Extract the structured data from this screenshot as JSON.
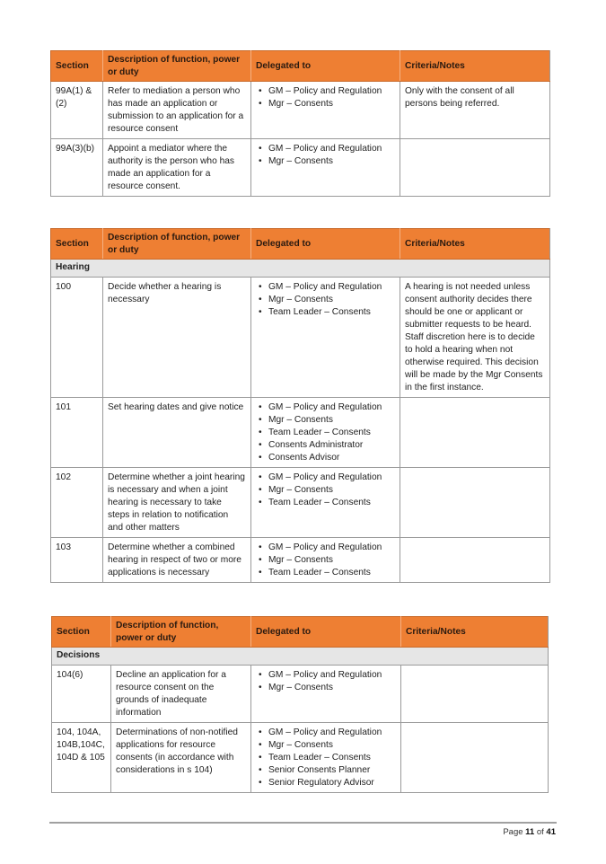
{
  "tables": [
    {
      "headers": [
        "Section",
        "Description of function, power or duty",
        "Delegated to",
        "Criteria/Notes"
      ],
      "group": null,
      "rows": [
        {
          "section": "99A(1) & (2)",
          "description": "Refer to mediation a person who has made an application or submission to an application for a resource consent",
          "delegated": [
            "GM – Policy and Regulation",
            "Mgr – Consents"
          ],
          "notes": "Only with the consent of all persons being referred."
        },
        {
          "section": "99A(3)(b)",
          "description": "Appoint a mediator where the authority is the person who has made an application for a resource consent.",
          "delegated": [
            "GM – Policy and Regulation",
            "Mgr – Consents"
          ],
          "notes": ""
        }
      ]
    },
    {
      "headers": [
        "Section",
        "Description of function, power or duty",
        "Delegated to",
        "Criteria/Notes"
      ],
      "group": "Hearing",
      "rows": [
        {
          "section": "100",
          "description": "Decide whether a hearing is necessary",
          "delegated": [
            "GM – Policy and Regulation",
            "Mgr – Consents",
            "Team Leader – Consents"
          ],
          "notes": "A hearing is not needed unless consent authority decides there should be one or applicant or submitter requests to be heard. Staff discretion here is to decide to hold a hearing when not otherwise required. This decision will be made by the Mgr Consents in the first instance."
        },
        {
          "section": "101",
          "description": "Set hearing dates and give notice",
          "delegated": [
            "GM – Policy and Regulation",
            "Mgr – Consents",
            "Team Leader – Consents",
            "Consents Administrator",
            "Consents Advisor"
          ],
          "notes": ""
        },
        {
          "section": "102",
          "description": "Determine whether a joint hearing is necessary and when a joint hearing is necessary to take steps in relation to notification and other matters",
          "delegated": [
            "GM – Policy and Regulation",
            "Mgr – Consents",
            "Team Leader – Consents"
          ],
          "notes": ""
        },
        {
          "section": "103",
          "description": "Determine whether a combined hearing in respect of two or more applications is necessary",
          "delegated": [
            "GM – Policy and Regulation",
            "Mgr – Consents",
            "Team Leader – Consents"
          ],
          "notes": ""
        }
      ]
    },
    {
      "headers": [
        "Section",
        "Description of function, power or duty",
        "Delegated to",
        "Criteria/Notes"
      ],
      "group": "Decisions",
      "rows": [
        {
          "section": "104(6)",
          "description": "Decline an application for a resource consent on the grounds of inadequate information",
          "delegated": [
            "GM – Policy and Regulation",
            "Mgr – Consents"
          ],
          "notes": ""
        },
        {
          "section": "104, 104A, 104B,104C, 104D & 105",
          "description": "Determinations of non-notified applications for resource consents (in accordance with considerations in s 104)",
          "delegated": [
            "GM – Policy and Regulation",
            "Mgr – Consents",
            "Team Leader – Consents",
            "Senior Consents Planner",
            "Senior Regulatory Advisor"
          ],
          "notes": ""
        }
      ]
    }
  ],
  "footer": {
    "page_prefix": "Page",
    "page_current": "11",
    "page_of": "of",
    "page_total": "41"
  },
  "colors": {
    "header_fill": "#ee7f33",
    "group_fill": "#e6e6e6",
    "border": "#9a9a9a"
  }
}
